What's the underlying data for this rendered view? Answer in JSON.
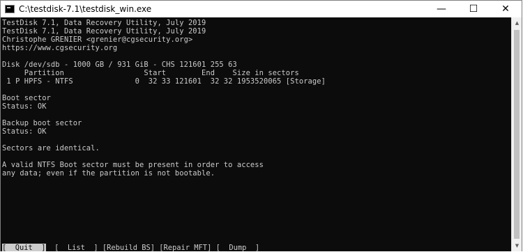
{
  "window": {
    "title": "C:\\testdisk-7.1\\testdisk_win.exe",
    "minimize": "—",
    "maximize": "☐",
    "close": "✕"
  },
  "console": {
    "lines": [
      "TestDisk 7.1, Data Recovery Utility, July 2019",
      "TestDisk 7.1, Data Recovery Utility, July 2019",
      "Christophe GRENIER <grenier@cgsecurity.org>",
      "https://www.cgsecurity.org",
      "",
      "Disk /dev/sdb - 1000 GB / 931 GiB - CHS 121601 255 63",
      "     Partition                  Start        End    Size in sectors",
      " 1 P HPFS - NTFS              0  32 33 121601  32 32 1953520065 [Storage]",
      "",
      "Boot sector",
      "Status: OK",
      "",
      "Backup boot sector",
      "Status: OK",
      "",
      "Sectors are identical.",
      "",
      "A valid NTFS Boot sector must be present in order to access",
      "any data; even if the partition is not bootable."
    ],
    "menu": {
      "quit": "[  Quit  ]",
      "list": "[  List  ]",
      "rebuild_bs": "[Rebuild BS]",
      "repair_mft": "[Repair MFT]",
      "dump": "[  Dump  ]"
    }
  }
}
